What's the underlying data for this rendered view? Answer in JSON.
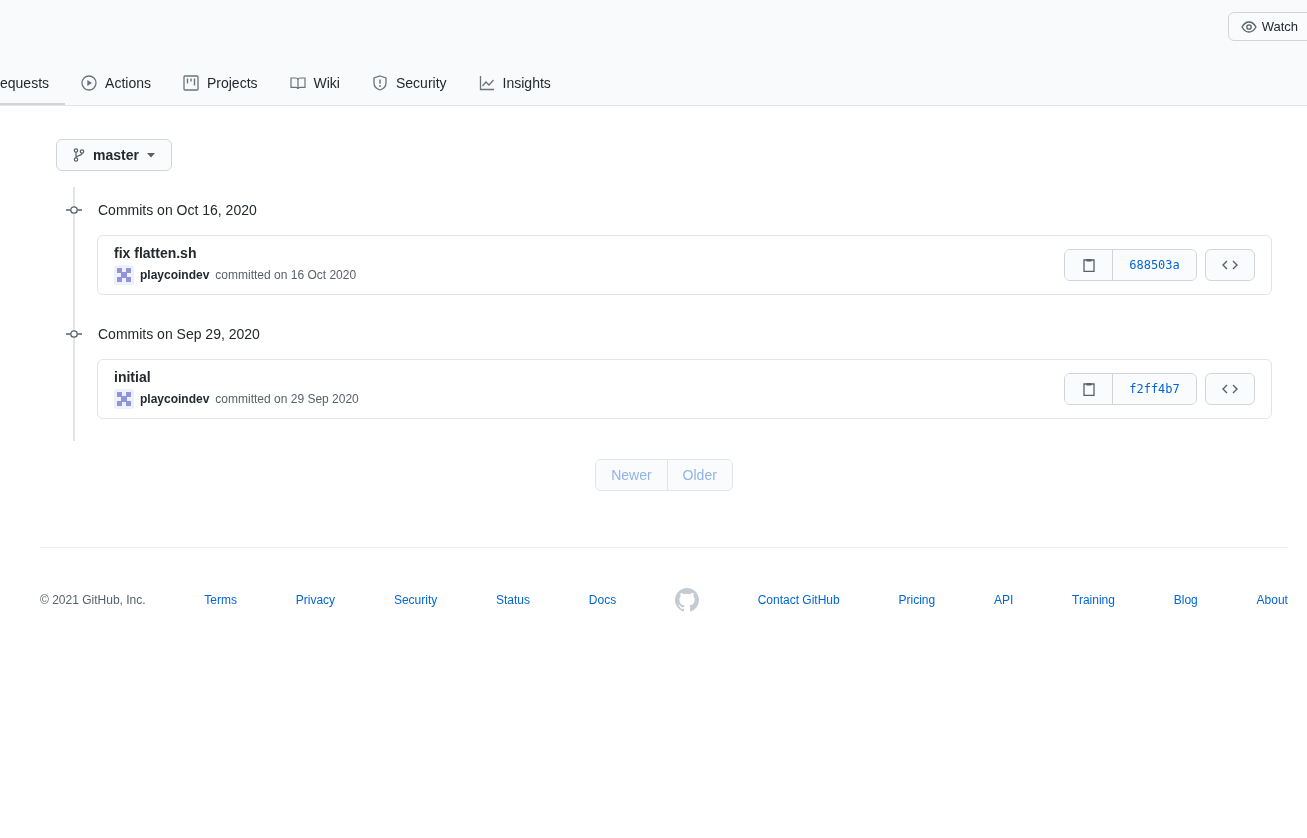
{
  "header": {
    "watch_button": "Watch"
  },
  "tabs": [
    {
      "label": "equests",
      "kind": "plain",
      "selected": true
    },
    {
      "label": "Actions",
      "kind": "actions",
      "selected": false
    },
    {
      "label": "Projects",
      "kind": "projects",
      "selected": false
    },
    {
      "label": "Wiki",
      "kind": "wiki",
      "selected": false
    },
    {
      "label": "Security",
      "kind": "security",
      "selected": false
    },
    {
      "label": "Insights",
      "kind": "insights",
      "selected": false
    }
  ],
  "branch": "master",
  "commit_groups": [
    {
      "date": "Commits on Oct 16, 2020",
      "commits": [
        {
          "message": "fix flatten.sh",
          "author": "playcoindev",
          "when": "committed on 16 Oct 2020",
          "sha": "688503a"
        }
      ]
    },
    {
      "date": "Commits on Sep 29, 2020",
      "commits": [
        {
          "message": "initial",
          "author": "playcoindev",
          "when": "committed on 29 Sep 2020",
          "sha": "f2ff4b7"
        }
      ]
    }
  ],
  "pagination": [
    {
      "label": "Newer",
      "disabled": true
    },
    {
      "label": "Older",
      "disabled": true
    }
  ],
  "footer": {
    "copyright": "© 2021 GitHub, Inc.",
    "left_links": [
      "Terms",
      "Privacy",
      "Security",
      "Status",
      "Docs"
    ],
    "right_links": [
      "Contact GitHub",
      "Pricing",
      "API",
      "Training",
      "Blog",
      "About"
    ]
  }
}
